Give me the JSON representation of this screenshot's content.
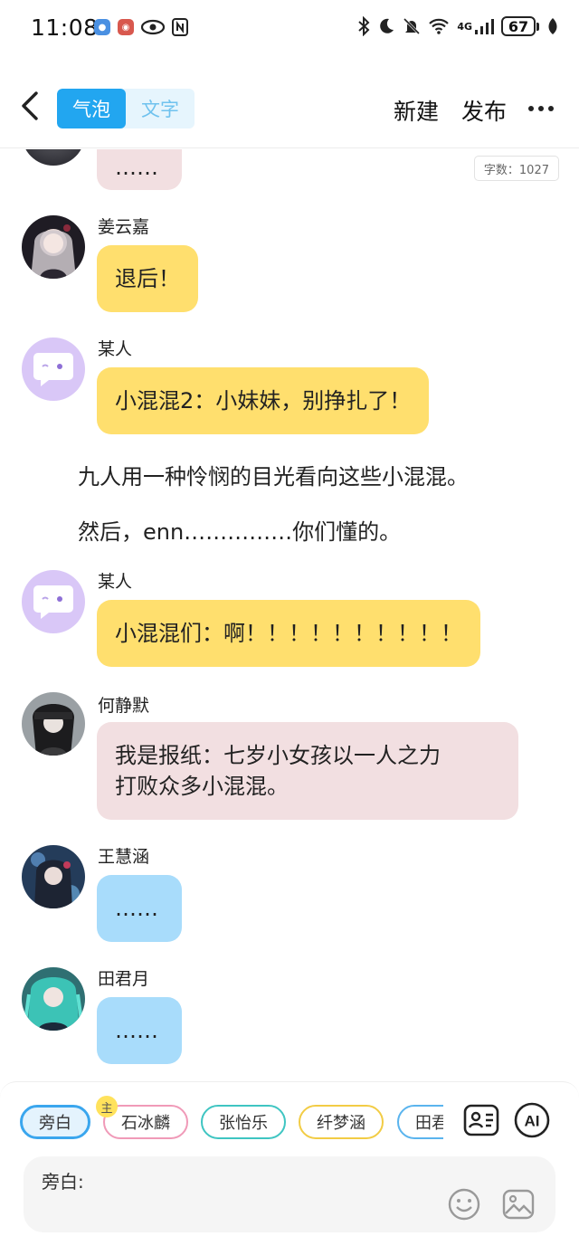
{
  "status_bar": {
    "time": "11:08",
    "network": "4G",
    "battery": "67"
  },
  "header": {
    "tabs": [
      {
        "label": "气泡",
        "active": true
      },
      {
        "label": "文字",
        "active": false
      }
    ],
    "new_label": "新建",
    "publish_label": "发布",
    "word_count": "字数：1027"
  },
  "messages": [
    {
      "type": "bubble",
      "speaker": "",
      "text": "……",
      "color": "pink"
    },
    {
      "type": "bubble",
      "speaker": "姜云嘉",
      "text": "退后！",
      "color": "yellow"
    },
    {
      "type": "bubble",
      "speaker": "某人",
      "text": "小混混2：小妹妹，别挣扎了！",
      "color": "yellow"
    },
    {
      "type": "narration",
      "text": "九人用一种怜悯的目光看向这些小混混。"
    },
    {
      "type": "narration",
      "text": "然后，enn……………你们懂的。"
    },
    {
      "type": "bubble",
      "speaker": "某人",
      "text": "小混混们：啊！！！！！！！！！！",
      "color": "yellow"
    },
    {
      "type": "bubble",
      "speaker": "何静默",
      "text_lines": [
        "我是报纸：七岁小女孩以一人之力",
        "打败众多小混混。"
      ],
      "color": "pink"
    },
    {
      "type": "bubble",
      "speaker": "王慧涵",
      "text": "……",
      "color": "blue"
    },
    {
      "type": "bubble",
      "speaker": "田君月",
      "text": "……",
      "color": "blue"
    }
  ],
  "characters": [
    {
      "label": "旁白",
      "selected": true,
      "border": "#3aa6ee"
    },
    {
      "label": "石冰麟",
      "selected": false,
      "border": "#f09ab8",
      "badge": "主"
    },
    {
      "label": "张怡乐",
      "selected": false,
      "border": "#3fc5c2"
    },
    {
      "label": "纤梦涵",
      "selected": false,
      "border": "#f2cc45"
    },
    {
      "label": "田君",
      "selected": false,
      "border": "#5ab4ee"
    }
  ],
  "input": {
    "label": "旁白:"
  },
  "colors": {
    "accent": "#22a6f0",
    "bubble_yellow": "#ffdf6e",
    "bubble_pink": "#f2dfe1",
    "bubble_blue": "#a8dcfb"
  },
  "icons": [
    "back-arrow-icon",
    "more-icon",
    "role-card-icon",
    "ai-icon",
    "emoji-icon",
    "image-icon"
  ]
}
